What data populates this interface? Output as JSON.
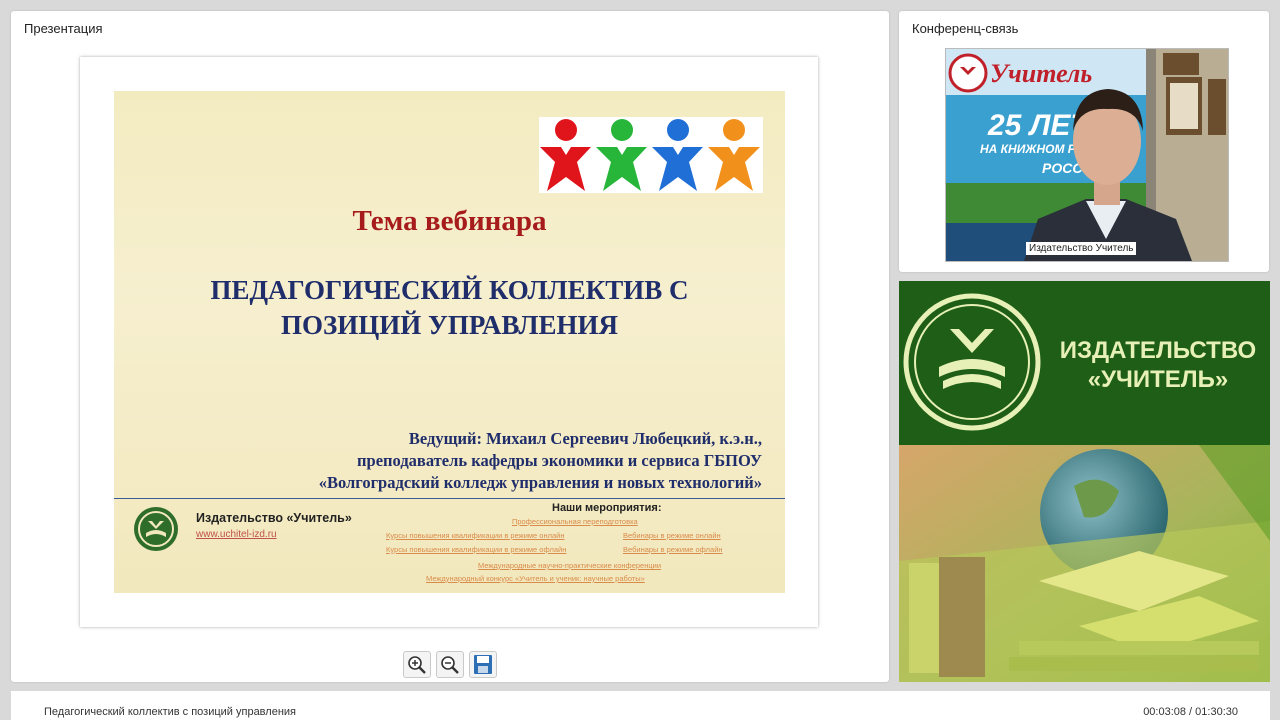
{
  "presentation": {
    "panel_title": "Презентация",
    "slide": {
      "heading": "Тема вебинара",
      "topic_line1": "ПЕДАГОГИЧЕСКИЙ КОЛЛЕКТИВ С",
      "topic_line2": "ПОЗИЦИЙ УПРАВЛЕНИЯ",
      "presenter_line1": "Ведущий: Михаил Сергеевич Любецкий, к.э.н.,",
      "presenter_line2": "преподаватель кафедры экономики и сервиса ГБПОУ",
      "presenter_line3": "«Волгоградский колледж управления и новых технологий»",
      "publisher": "Издательство «Учитель»",
      "url": "www.uchitel-izd.ru",
      "events_title": "Наши мероприятия:",
      "events": [
        "Профессиональная переподготовка",
        "Курсы повышения квалификации в режиме онлайн",
        "Вебинары в режиме онлайн",
        "Курсы повышения квалификации в режиме офлайн",
        "Вебинары в режиме офлайн",
        "Международные научно-практические конференции",
        "Международный конкурс «Учитель и ученик: научные работы»"
      ]
    },
    "toolbar": {
      "zoom_in": "zoom-in-icon",
      "zoom_out": "zoom-out-icon",
      "save": "save-icon"
    }
  },
  "conference": {
    "panel_title": "Конференц-связь",
    "video_label": "Издательство Учитель",
    "backdrop_brand": "Учитель",
    "backdrop_years": "25 ЛЕТ",
    "backdrop_line": "НА КНИЖНОМ РЫНКЕ",
    "backdrop_country": "РОСС"
  },
  "banner": {
    "line1": "ИЗДАТЕЛЬСТВО",
    "line2": "«УЧИТЕЛЬ»"
  },
  "bottom": {
    "title": "Педагогический коллектив с позиций управления",
    "time": "00:03:08 / 01:30:30"
  },
  "colors": {
    "accent_green": "#1f5e16",
    "title_red": "#a61b1b",
    "topic_blue": "#1f2d6b"
  }
}
